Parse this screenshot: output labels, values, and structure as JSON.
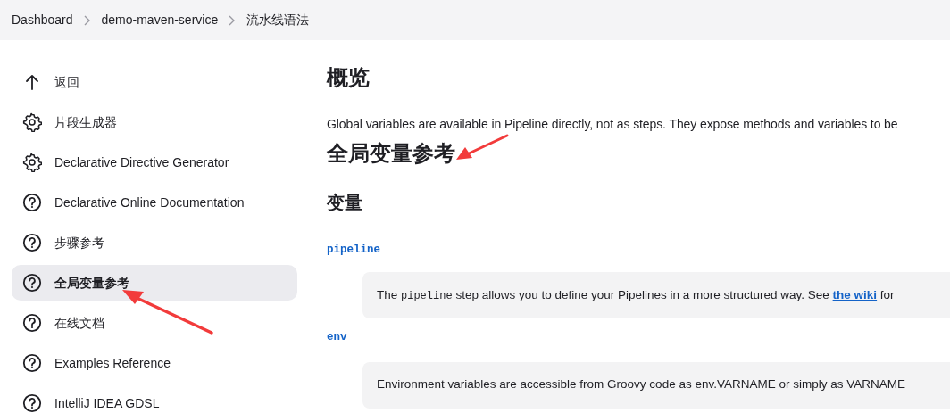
{
  "breadcrumbs": [
    {
      "label": "Dashboard"
    },
    {
      "label": "demo-maven-service"
    },
    {
      "label": "流水线语法"
    }
  ],
  "sidebar": {
    "items": [
      {
        "label": "返回",
        "kind": "back",
        "selected": false,
        "pointed": false
      },
      {
        "label": "片段生成器",
        "kind": "generator",
        "selected": false,
        "pointed": false
      },
      {
        "label": "Declarative Directive Generator",
        "kind": "generator",
        "selected": false,
        "pointed": false
      },
      {
        "label": "Declarative Online Documentation",
        "kind": "help",
        "selected": false,
        "pointed": false
      },
      {
        "label": "步骤参考",
        "kind": "help",
        "selected": false,
        "pointed": false
      },
      {
        "label": "全局变量参考",
        "kind": "help",
        "selected": true,
        "pointed": true
      },
      {
        "label": "在线文档",
        "kind": "help",
        "selected": false,
        "pointed": false
      },
      {
        "label": "Examples Reference",
        "kind": "help",
        "selected": false,
        "pointed": false
      },
      {
        "label": "IntelliJ IDEA GDSL",
        "kind": "help",
        "selected": false,
        "pointed": false
      }
    ]
  },
  "content": {
    "overview_title": "概览",
    "intro": "Global variables are available in Pipeline directly, not as steps. They expose methods and variables to be",
    "title": "全局变量参考",
    "title_pointed": true,
    "variables_title": "变量",
    "variables": [
      {
        "name": "pipeline",
        "description": [
          {
            "kind": "text",
            "text": "The "
          },
          {
            "kind": "code",
            "text": "pipeline"
          },
          {
            "kind": "text",
            "text": " step allows you to define your Pipelines in a more structured way. See "
          },
          {
            "kind": "link",
            "text": "the wiki"
          },
          {
            "kind": "text",
            "text": " for"
          }
        ]
      },
      {
        "name": "env",
        "description": [
          {
            "kind": "text",
            "text": "Environment variables are accessible from Groovy code as env.VARNAME or simply as VARNAME"
          }
        ]
      }
    ]
  }
}
